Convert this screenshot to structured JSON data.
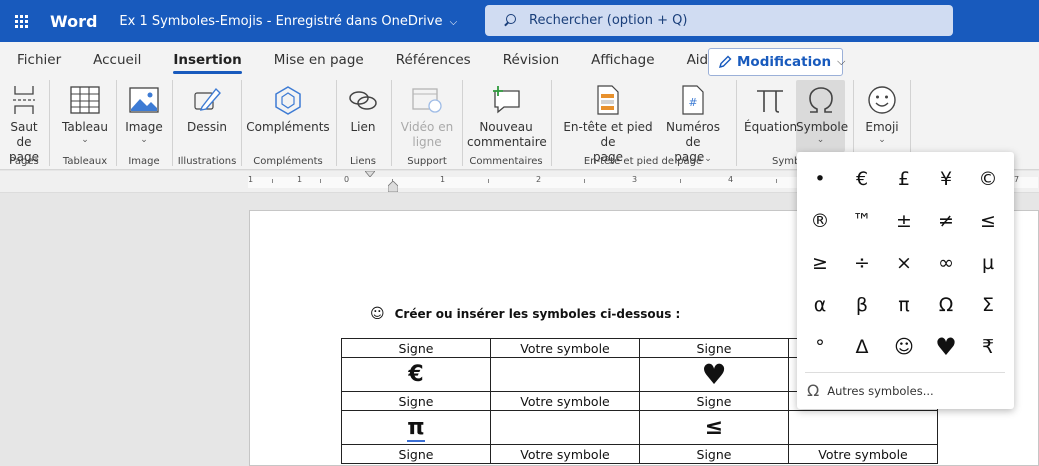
{
  "titlebar": {
    "app_name": "Word",
    "doc_title": "Ex 1 Symboles-Emojis",
    "save_status": "Enregistré dans OneDrive",
    "chevron": "⌵",
    "search_placeholder": "Rechercher (option + Q)"
  },
  "tabs": [
    "Fichier",
    "Accueil",
    "Insertion",
    "Mise en page",
    "Références",
    "Révision",
    "Affichage",
    "Aide"
  ],
  "active_tab": "Insertion",
  "mode_button": {
    "label": "Modification",
    "chevron": "⌵"
  },
  "ribbon": {
    "saut": {
      "label1": "Saut de",
      "label2": "page"
    },
    "tableau": {
      "label": "Tableau",
      "chevron": "⌄"
    },
    "image": {
      "label": "Image",
      "chevron": "⌄"
    },
    "dessin": {
      "label": "Dessin"
    },
    "complements": {
      "label": "Compléments"
    },
    "lien": {
      "label": "Lien"
    },
    "video": {
      "label1": "Vidéo en",
      "label2": "ligne"
    },
    "commentaire": {
      "label1": "Nouveau",
      "label2": "commentaire"
    },
    "entete": {
      "label1": "En-tête et pied de",
      "label2": "page"
    },
    "numeros": {
      "label1": "Numéros de",
      "label2": "page",
      "chevron": "⌄"
    },
    "equation": {
      "label": "Équation"
    },
    "symbole": {
      "label": "Symbole",
      "chevron": "⌄"
    },
    "emoji": {
      "label": "Emoji",
      "chevron": "⌄"
    },
    "groups": {
      "pages": "Pages",
      "tableaux": "Tableaux",
      "image": "Image",
      "illustrations": "Illustrations",
      "complements": "Compléments",
      "liens": "Liens",
      "support": "Support",
      "commentaires": "Commentaires",
      "entete": "En-tête et pied de page",
      "symboles": "Symb"
    }
  },
  "ruler": {
    "numbers": [
      "1",
      "1",
      "0",
      "1",
      "2",
      "3",
      "4",
      "7"
    ]
  },
  "document": {
    "heading_icon": "☺",
    "heading": "Créer ou insérer les symboles ci-dessous :",
    "header_row": [
      "Signe",
      "Votre symbole",
      "Signe",
      ""
    ],
    "header_row_last": [
      "Signe",
      "Votre symbole",
      "Signe",
      "Votre symbole"
    ],
    "row1": [
      "€",
      "",
      "♥",
      ""
    ],
    "row2": [
      "π",
      "",
      "≤",
      ""
    ]
  },
  "symbol_dropdown": {
    "symbols": [
      "•",
      "€",
      "£",
      "¥",
      "©",
      "®",
      "™",
      "±",
      "≠",
      "≤",
      "≥",
      "÷",
      "×",
      "∞",
      "µ",
      "α",
      "β",
      "π",
      "Ω",
      "Σ",
      "°",
      "Δ",
      "☺",
      "♥",
      "₹"
    ],
    "more_icon": "Ω",
    "more_label": "Autres symboles..."
  },
  "colors": {
    "accent": "#185abd",
    "ribbon_bg": "#f3f3f3",
    "canvas_bg": "#e6e6e6"
  }
}
